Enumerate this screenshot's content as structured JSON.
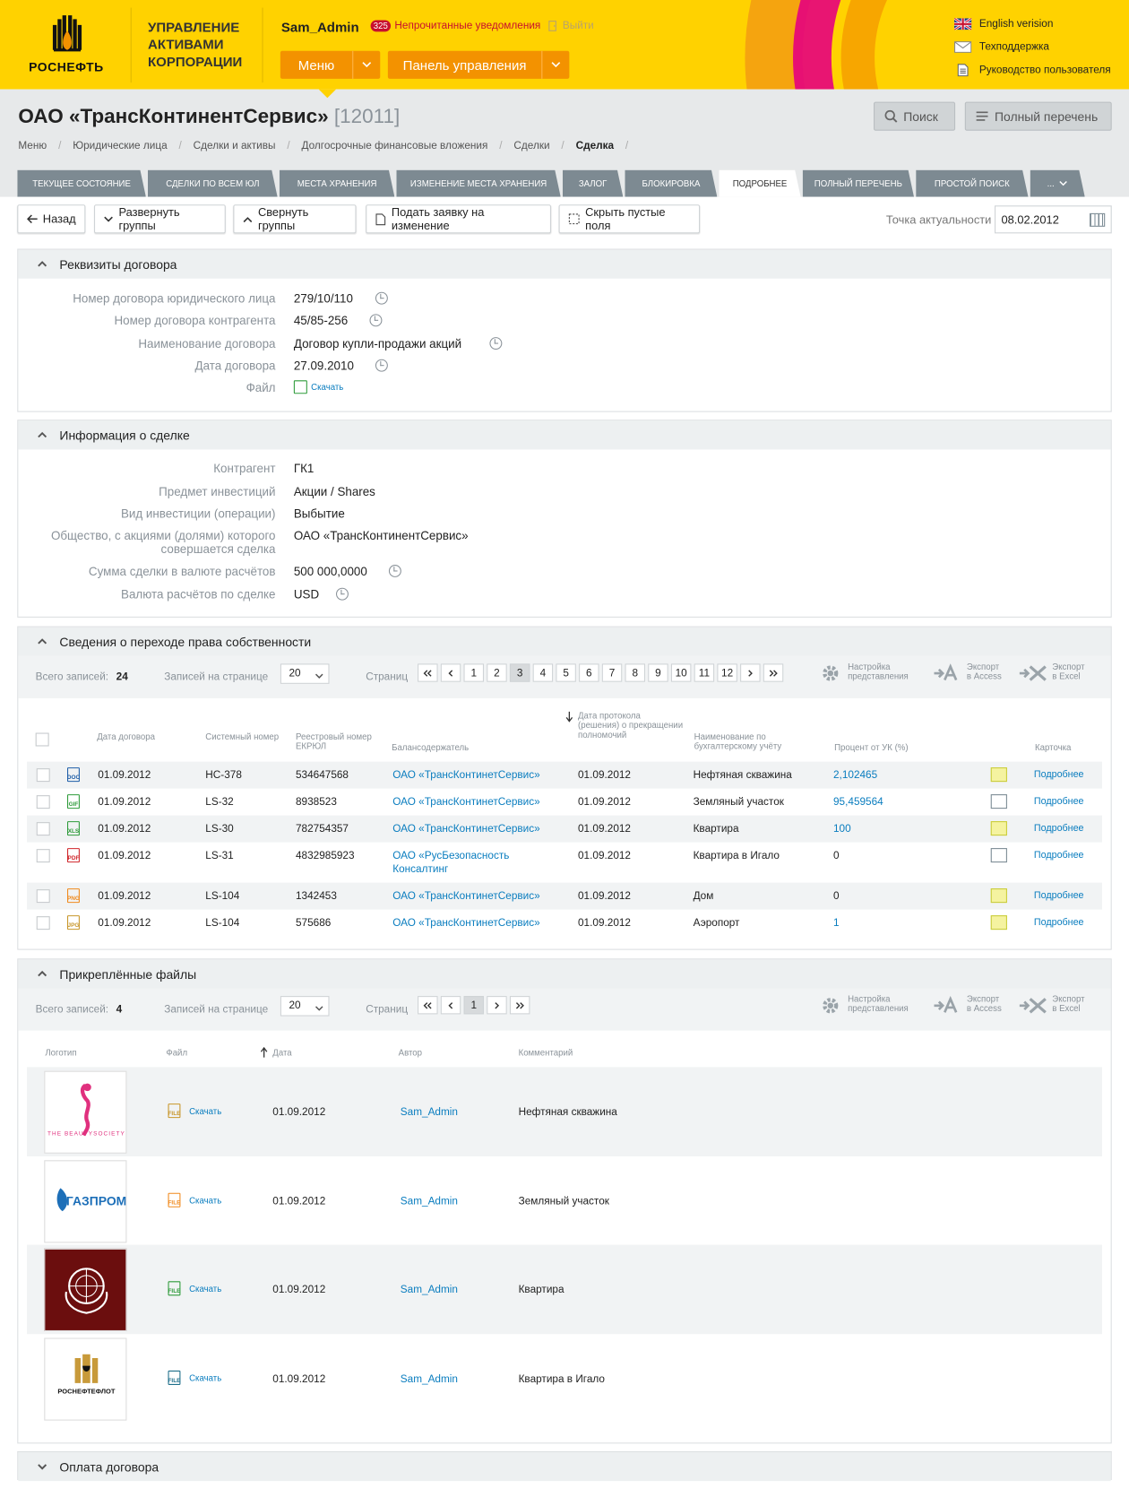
{
  "header": {
    "logo_text": "РОСНЕФТЬ",
    "company": [
      "УПРАВЛЕНИЕ",
      "АКТИВАМИ",
      "КОРПОРАЦИИ"
    ],
    "user": "Sam_Admin",
    "notif_count": "325",
    "notif_label": "Непрочитанные уведомления",
    "logout": "Выйти",
    "menu_btn": "Меню",
    "panel_btn": "Панель управления",
    "links": [
      "English verision",
      "Техподдержка",
      "Руководство пользователя"
    ]
  },
  "page": {
    "title": "ОАО «ТрансКонтинентСервис»",
    "title_id": "[12011]",
    "search_btn": "Поиск",
    "full_list_btn": "Полный перечень",
    "breadcrumbs": [
      "Меню",
      "Юридические лица",
      "Сделки и активы",
      "Долгосрочные финансовые вложения",
      "Сделки",
      "Сделка"
    ],
    "tabs": [
      "ТЕКУЩЕЕ СОСТОЯНИЕ",
      "СДЕЛКИ ПО ВСЕМ ЮЛ",
      "МЕСТА ХРАНЕНИЯ",
      "ИЗМЕНЕНИЕ МЕСТА ХРАНЕНИЯ",
      "ЗАЛОГ",
      "БЛОКИРОВКА",
      "ПОДРОБНЕЕ",
      "ПОЛНЫЙ ПЕРЕЧЕНЬ",
      "ПРОСТОЙ ПОИСК",
      "..."
    ]
  },
  "toolbar": {
    "back": "Назад",
    "expand": "Развернуть группы",
    "collapse": "Свернуть группы",
    "request": "Подать заявку на изменение",
    "hide_empty": "Скрыть пустые поля",
    "actual_label": "Точка актуальности",
    "actual_date": "08.02.2012"
  },
  "contract": {
    "title": "Реквизиты договора",
    "fields": [
      {
        "k": "Номер договора юридического лица",
        "v": "279/10/110"
      },
      {
        "k": "Номер договора контрагента",
        "v": "45/85-256"
      },
      {
        "k": "Наименование договора",
        "v": "Договор купли-продажи акций"
      },
      {
        "k": "Дата договора",
        "v": "27.09.2010"
      },
      {
        "k": "Файл",
        "v": "Скачать"
      }
    ]
  },
  "deal": {
    "title": "Информация о сделке",
    "fields": [
      {
        "k": "Контрагент",
        "v": "ГК1"
      },
      {
        "k": "Предмет инвестиций",
        "v": "Акции / Shares"
      },
      {
        "k": "Вид инвестиции (операции)",
        "v": "Выбытие"
      },
      {
        "k": "Общество, с акциями (долями) которого",
        "k2": "совершается сделка",
        "v": "ОАО «ТрансКонтинентСервис»"
      },
      {
        "k": "Сумма сделки в валюте расчётов",
        "v": "500 000,0000"
      },
      {
        "k": "Валюта расчётов по сделке",
        "v": "USD"
      }
    ]
  },
  "ownership": {
    "title": "Сведения о переходе права собственности",
    "total_label": "Всего записей:",
    "total": "24",
    "per_page_label": "Записей на странице",
    "per_page": "20",
    "pages_label": "Страниц",
    "pages": [
      "1",
      "2",
      "3",
      "4",
      "5",
      "6",
      "7",
      "8",
      "9",
      "10",
      "11",
      "12"
    ],
    "current_page": "3",
    "settings": [
      "Настройка",
      "представления"
    ],
    "access": [
      "Экспорт",
      "в Access"
    ],
    "excel": [
      "Экспорт",
      "в Excel"
    ],
    "headers": [
      "Дата договора",
      "Системный номер",
      "Реестровый номер ЕКРЮЛ",
      "Балансодержатель",
      "Дата протокола (решения) о прекращении полномочий",
      "Наименование по бухгалтерскому учёту",
      "Процент от УК (%)",
      "Карточка"
    ],
    "rows": [
      {
        "date": "01.09.2012",
        "sys": "НС-378",
        "reg": "534647568",
        "holder": "ОАО «ТрансКонтинетСервис»",
        "holder2": "",
        "prot": "01.09.2012",
        "name": "Нефтяная скважина",
        "pct": "2,102465",
        "pct_link": true,
        "card": "Подробнее",
        "icon": "doc",
        "icolor": "#1f5fa8"
      },
      {
        "date": "01.09.2012",
        "sys": "LS-32",
        "reg": "8938523",
        "holder": "ОАО «ТрансКонтинетСервис»",
        "holder2": "",
        "prot": "01.09.2012",
        "name": "Земляный участок",
        "pct": "95,459564",
        "pct_link": true,
        "card": "Подробнее",
        "icon": "gif",
        "icolor": "#2e9b3a"
      },
      {
        "date": "01.09.2012",
        "sys": "LS-30",
        "reg": "782754357",
        "holder": "ОАО «ТрансКонтинетСервис»",
        "holder2": "",
        "prot": "01.09.2012",
        "name": "Квартира",
        "pct": "100",
        "pct_link": true,
        "card": "Подробнее",
        "icon": "xls",
        "icolor": "#2e9b3a"
      },
      {
        "date": "01.09.2012",
        "sys": "LS-31",
        "reg": "4832985923",
        "holder": "ОАО «РусБезопасность",
        "holder2": "Консалтинг",
        "prot": "01.09.2012",
        "name": "Квартира в Игало",
        "pct": "0",
        "pct_link": false,
        "card": "Подробнее",
        "icon": "pdf",
        "icolor": "#d0262b"
      },
      {
        "date": "01.09.2012",
        "sys": "LS-104",
        "reg": "1342453",
        "holder": "ОАО «ТрансКонтинетСервис»",
        "holder2": "",
        "prot": "01.09.2012",
        "name": "Дом",
        "pct": "0",
        "pct_link": false,
        "card": "Подробнее",
        "icon": "png",
        "icolor": "#f08a1d"
      },
      {
        "date": "01.09.2012",
        "sys": "LS-104",
        "reg": "575686",
        "holder": "ОАО «ТрансКонтинетСервис»",
        "holder2": "",
        "prot": "01.09.2012",
        "name": "Аэропорт",
        "pct": "1",
        "pct_link": true,
        "card": "Подробнее",
        "icon": "jpg",
        "icolor": "#c8962a"
      }
    ]
  },
  "files": {
    "title": "Прикреплённые файлы",
    "total_label": "Всего записей:",
    "total": "4",
    "per_page_label": "Записей на странице",
    "per_page": "20",
    "pages_label": "Страниц",
    "pages": [
      "1"
    ],
    "headers": [
      "Логотип",
      "Файл",
      "Дата",
      "Автор",
      "Комментарий"
    ],
    "rows": [
      {
        "logo": "beauty",
        "logo_text": "THE BEAUTYSOCIETY",
        "link": "Скачать",
        "date": "01.09.2012",
        "author": "Sam_Admin",
        "comment": "Нефтяная скважина",
        "icolor": "#c8962a"
      },
      {
        "logo": "gazprom",
        "logo_text": "ГАЗПРОМ",
        "link": "Скачать",
        "date": "01.09.2012",
        "author": "Sam_Admin",
        "comment": "Земляный участок",
        "icolor": "#f08a1d"
      },
      {
        "logo": "un",
        "logo_text": "",
        "link": "Скачать",
        "date": "01.09.2012",
        "author": "Sam_Admin",
        "comment": "Квартира",
        "icolor": "#2e9b3a"
      },
      {
        "logo": "rfl",
        "logo_text": "РОСНЕФТЕФЛОТ",
        "link": "Скачать",
        "date": "01.09.2012",
        "author": "Sam_Admin",
        "comment": "Квартира в Игало",
        "icolor": "#1f6f8b"
      }
    ]
  },
  "payment": {
    "title": "Оплата договора"
  }
}
